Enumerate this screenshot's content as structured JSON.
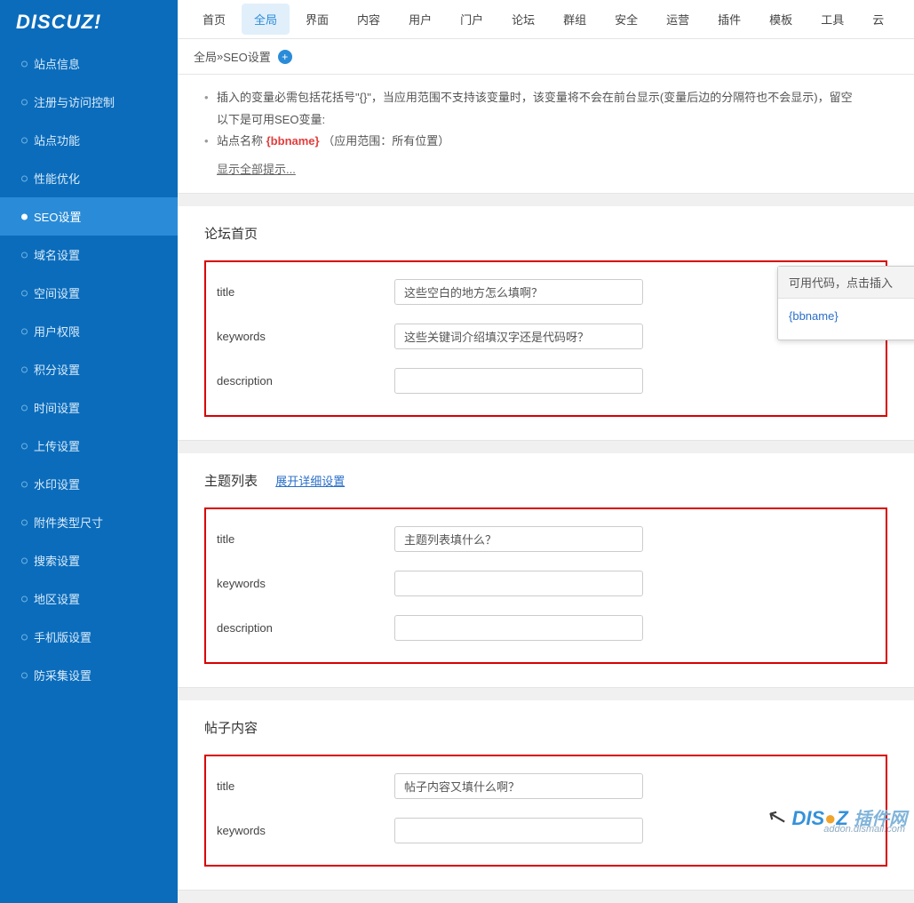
{
  "logo": "DISCUZ!",
  "sidebar": {
    "items": [
      {
        "label": "站点信息"
      },
      {
        "label": "注册与访问控制"
      },
      {
        "label": "站点功能"
      },
      {
        "label": "性能优化"
      },
      {
        "label": "SEO设置",
        "active": true
      },
      {
        "label": "域名设置"
      },
      {
        "label": "空间设置"
      },
      {
        "label": "用户权限"
      },
      {
        "label": "积分设置"
      },
      {
        "label": "时间设置"
      },
      {
        "label": "上传设置"
      },
      {
        "label": "水印设置"
      },
      {
        "label": "附件类型尺寸"
      },
      {
        "label": "搜索设置"
      },
      {
        "label": "地区设置"
      },
      {
        "label": "手机版设置"
      },
      {
        "label": "防采集设置"
      }
    ]
  },
  "topnav": {
    "items": [
      {
        "label": "首页"
      },
      {
        "label": "全局",
        "active": true
      },
      {
        "label": "界面"
      },
      {
        "label": "内容"
      },
      {
        "label": "用户"
      },
      {
        "label": "门户"
      },
      {
        "label": "论坛"
      },
      {
        "label": "群组"
      },
      {
        "label": "安全"
      },
      {
        "label": "运营"
      },
      {
        "label": "插件"
      },
      {
        "label": "模板"
      },
      {
        "label": "工具"
      },
      {
        "label": "云"
      }
    ]
  },
  "breadcrumb": {
    "part1": "全局",
    "sep": " » ",
    "part2": "SEO设置",
    "plus": "+"
  },
  "notes": {
    "line1a": "插入的变量必需包括花括号\"{}\"，当应用范围不支持该变量时，该变量将不会在前台显示(变量后边的分隔符也不会显示)，留空",
    "line1b": "以下是可用SEO变量:",
    "line2a": "站点名称 ",
    "line2code": "{bbname}",
    "line2b": "（应用范围：所有位置）",
    "showall": "显示全部提示..."
  },
  "sections": {
    "forum_home": {
      "title": "论坛首页",
      "fields": {
        "title": {
          "label": "title",
          "value": "这些空白的地方怎么填啊？"
        },
        "keywords": {
          "label": "keywords",
          "value": "这些关键词介绍填汉字还是代码呀？"
        },
        "description": {
          "label": "description",
          "value": ""
        }
      },
      "popup": {
        "head": "可用代码，点击插入",
        "arrow": "→",
        "code": "{bbname}"
      }
    },
    "thread_list": {
      "title": "主题列表",
      "expand": "展开详细设置",
      "fields": {
        "title": {
          "label": "title",
          "value": "主题列表填什么？"
        },
        "keywords": {
          "label": "keywords",
          "value": ""
        },
        "description": {
          "label": "description",
          "value": ""
        }
      }
    },
    "post_content": {
      "title": "帖子内容",
      "fields": {
        "title": {
          "label": "title",
          "value": "帖子内容又填什么啊？"
        },
        "keywords": {
          "label": "keywords",
          "value": ""
        }
      }
    }
  },
  "watermark": {
    "brand1": "DIS",
    "brand2": "Z",
    "cn": "插件网",
    "sub": "addon.dismall.com"
  }
}
